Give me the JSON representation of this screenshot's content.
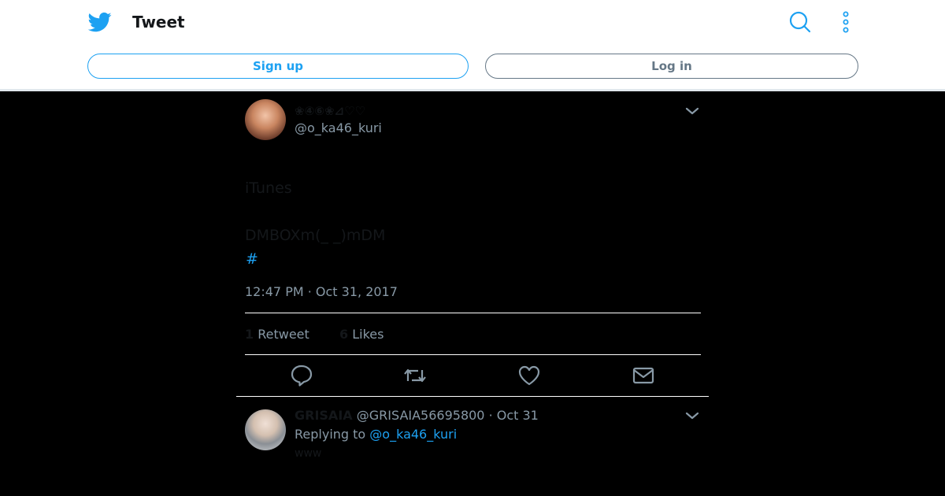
{
  "header": {
    "title": "Tweet",
    "signup_label": "Sign up",
    "login_label": "Log in",
    "brand_color": "#1da1f2"
  },
  "tweet": {
    "display_name": "❀④⑥❀⊿♡♡",
    "handle": "@o_ka46_kuri",
    "text_line1": "iTunes",
    "text_line2": "DMBOXm(_ _)mDM",
    "hashtag": "#",
    "timestamp": "12:47 PM · Oct 31, 2017",
    "retweet_count": "1",
    "retweet_label": "Retweet",
    "like_count": "6",
    "like_label": "Likes"
  },
  "actions": {
    "icons": [
      "reply-icon",
      "retweet-icon",
      "like-icon",
      "message-icon"
    ]
  },
  "reply": {
    "display_name": "GRISAIA",
    "handle_date": "@GRISAIA56695800 · Oct 31",
    "replying_to_label": "Replying to",
    "replying_to_handle": "@o_ka46_kuri",
    "text": "www"
  }
}
